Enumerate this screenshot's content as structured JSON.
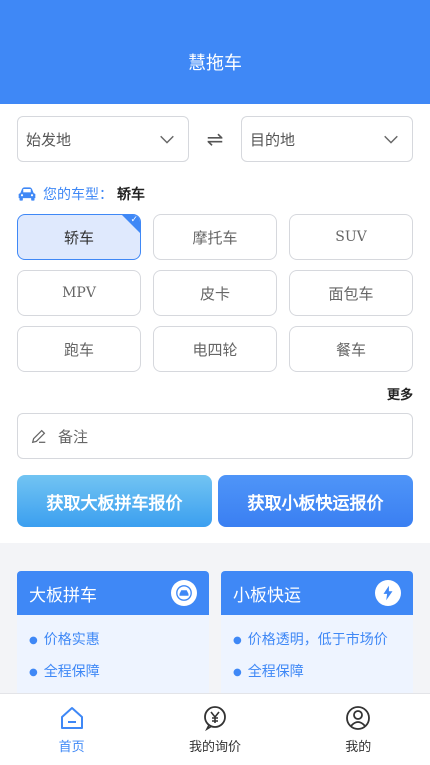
{
  "header": {
    "title": "慧拖车"
  },
  "route": {
    "origin_placeholder": "始发地",
    "swap_icon": "⇌",
    "destination_placeholder": "目的地"
  },
  "car_type": {
    "label": "您的车型：",
    "value": "轿车"
  },
  "vehicle_options": [
    {
      "label": "轿车",
      "selected": true
    },
    {
      "label": "摩托车",
      "selected": false
    },
    {
      "label": "SUV",
      "selected": false
    },
    {
      "label": "MPV",
      "selected": false
    },
    {
      "label": "皮卡",
      "selected": false
    },
    {
      "label": "面包车",
      "selected": false
    },
    {
      "label": "跑车",
      "selected": false
    },
    {
      "label": "电四轮",
      "selected": false
    },
    {
      "label": "餐车",
      "selected": false
    }
  ],
  "more_label": "更多",
  "remark": {
    "placeholder": "备注"
  },
  "buttons": {
    "big_board_quote": "获取大板拼车报价",
    "small_board_quote": "获取小板快运报价"
  },
  "cards": [
    {
      "title": "大板拼车",
      "icon": "car-badge-icon",
      "features": [
        "价格实惠",
        "全程保障"
      ]
    },
    {
      "title": "小板快运",
      "icon": "lightning-icon",
      "features": [
        "价格透明，低于市场价",
        "全程保障"
      ]
    }
  ],
  "tabbar": [
    {
      "label": "首页",
      "icon": "home-icon",
      "active": true
    },
    {
      "label": "我的询价",
      "icon": "yen-chat-icon",
      "active": false
    },
    {
      "label": "我的",
      "icon": "user-icon",
      "active": false
    }
  ],
  "colors": {
    "primary": "#3f88f6",
    "selected_bg": "#dfe9fd",
    "gradient_light": "#72c4f2"
  }
}
